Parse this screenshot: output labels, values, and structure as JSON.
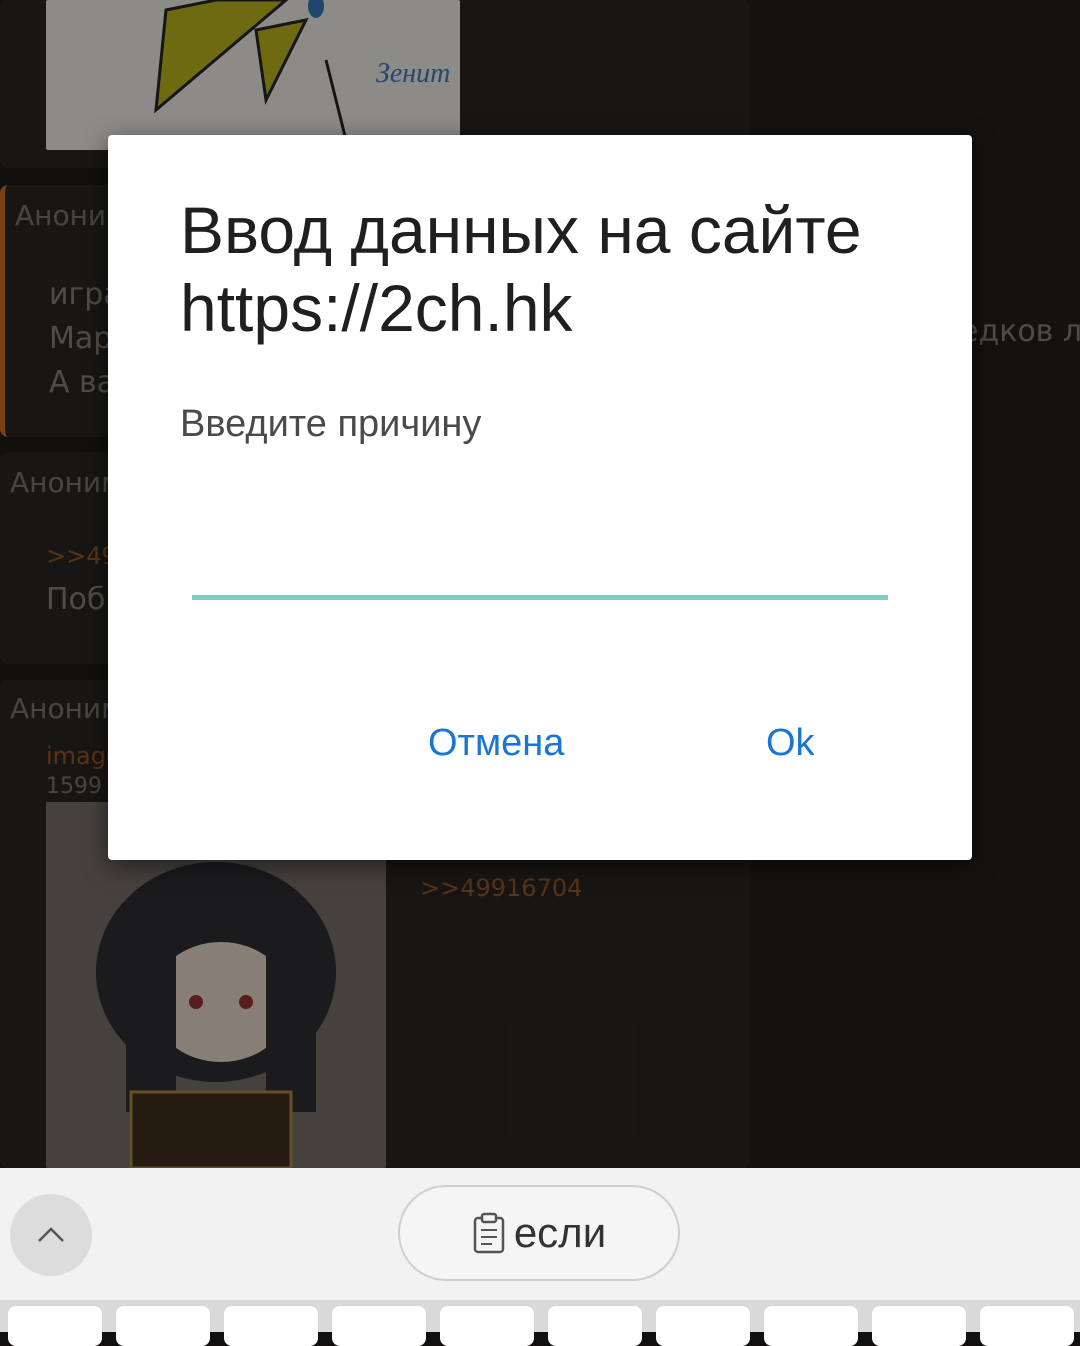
{
  "background_thread": {
    "posts": [
      {
        "author": "Аноним",
        "lines": [
          "игра",
          "Мар",
          "А ва"
        ],
        "trailing": "едков л"
      },
      {
        "author": "Аноним",
        "reply_link": ">>49",
        "lines": [
          "Поб"
        ]
      },
      {
        "author": "Аноним",
        "file_name": "image",
        "file_info": "1599"
      }
    ],
    "reply_link_right": ">>49916704",
    "logo_text": "Зенит"
  },
  "dialog": {
    "title": "Ввод данных на сайте https://2ch.hk",
    "message": "Введите причину",
    "input_value": "",
    "cancel_label": "Отмена",
    "ok_label": "Ok",
    "accent_color": "#1976d2",
    "input_underline_color": "#7fcfc4"
  },
  "keyboard": {
    "collapse_icon": "chevron-up-icon",
    "suggestion_icon": "clipboard-icon",
    "suggestion": "если"
  }
}
